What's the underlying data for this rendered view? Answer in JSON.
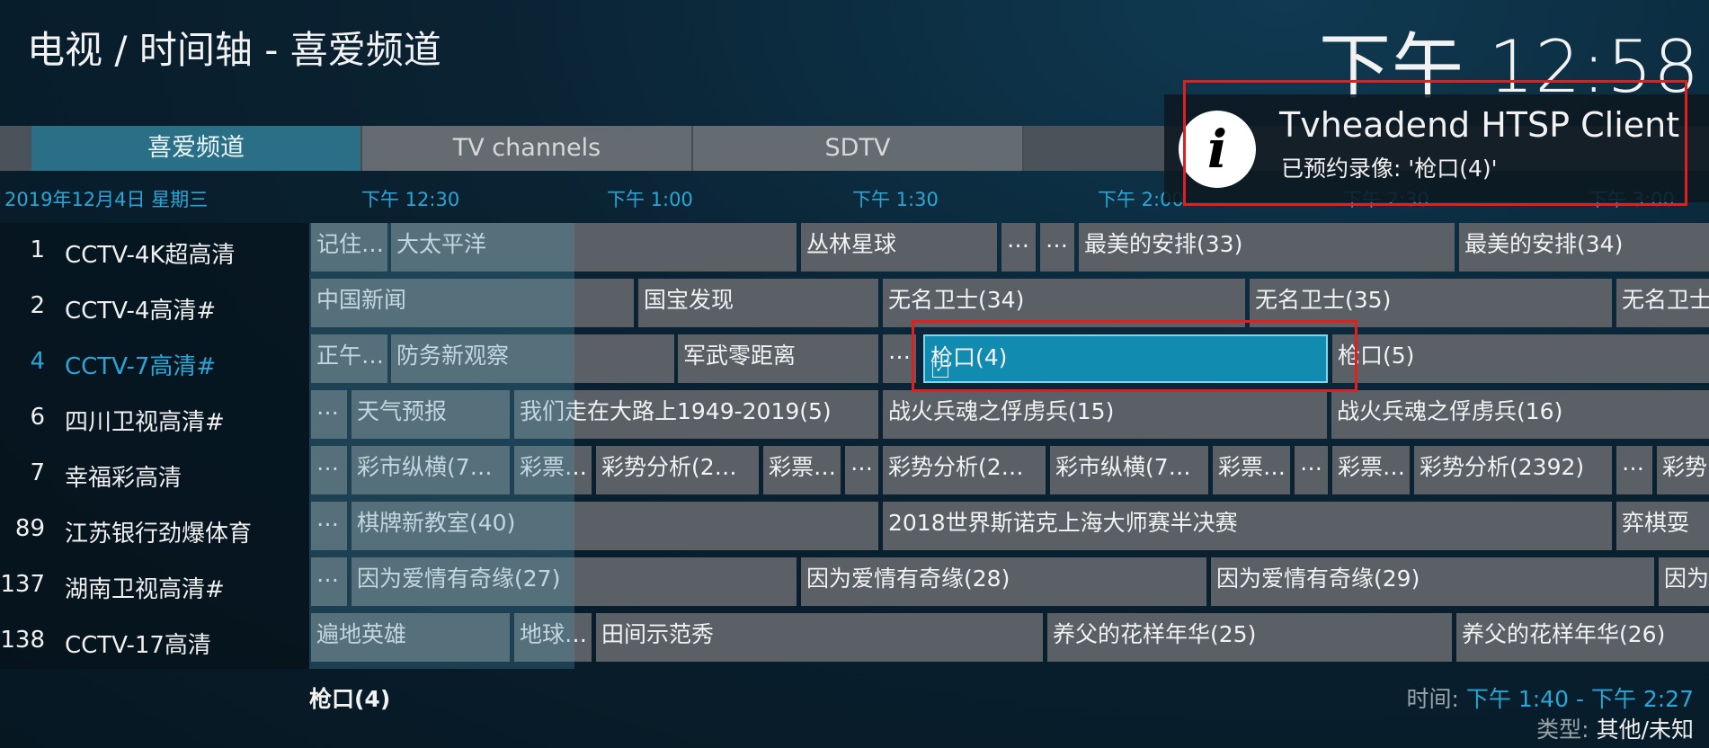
{
  "header": {
    "title": "电视 / 时间轴 - 喜爱频道",
    "clock": "下午 12:58"
  },
  "tabs": [
    {
      "label": "喜爱频道",
      "active": true
    },
    {
      "label": "TV channels",
      "active": false
    },
    {
      "label": "SDTV",
      "active": false
    }
  ],
  "date": "2019年12月4日 星期三",
  "times": [
    "下午 12:30",
    "下午 1:00",
    "下午 1:30",
    "下午 2:00",
    "下午 2:30",
    "下午 3:00"
  ],
  "channels": [
    {
      "num": "1",
      "name": "CCTV-4K超高清",
      "active": false
    },
    {
      "num": "2",
      "name": "CCTV-4高清#",
      "active": false
    },
    {
      "num": "4",
      "name": "CCTV-7高清#",
      "active": true
    },
    {
      "num": "6",
      "name": "四川卫视高清#",
      "active": false
    },
    {
      "num": "7",
      "name": "幸福彩高清",
      "active": false
    },
    {
      "num": "89",
      "name": "江苏银行劲爆体育",
      "active": false
    },
    {
      "num": "137",
      "name": "湖南卫视高清#",
      "active": false
    },
    {
      "num": "138",
      "name": "CCTV-17高清",
      "active": false
    }
  ],
  "programs": [
    [
      {
        "title": "记住…"
      },
      {
        "title": "大太平洋"
      },
      {
        "title": "丛林星球"
      },
      {
        "title": "…"
      },
      {
        "title": "…"
      },
      {
        "title": "最美的安排(33)"
      },
      {
        "title": "最美的安排(34)"
      }
    ],
    [
      {
        "title": "中国新闻"
      },
      {
        "title": "国宝发现"
      },
      {
        "title": "无名卫士(34)"
      },
      {
        "title": "无名卫士(35)"
      },
      {
        "title": "无名卫士"
      }
    ],
    [
      {
        "title": "正午…"
      },
      {
        "title": "防务新观察"
      },
      {
        "title": "军武零距离"
      },
      {
        "title": "…"
      },
      {
        "title": "枪口(4)",
        "selected": true,
        "timer": true
      },
      {
        "title": "枪口(5)"
      }
    ],
    [
      {
        "title": "…"
      },
      {
        "title": "天气预报"
      },
      {
        "title": "我们走在大路上1949-2019(5)"
      },
      {
        "title": "战火兵魂之俘虏兵(15)"
      },
      {
        "title": "战火兵魂之俘虏兵(16)"
      }
    ],
    [
      {
        "title": "…"
      },
      {
        "title": "彩市纵横(7…"
      },
      {
        "title": "彩票…"
      },
      {
        "title": "彩势分析(2…"
      },
      {
        "title": "彩票…"
      },
      {
        "title": "…"
      },
      {
        "title": "彩势分析(2…"
      },
      {
        "title": "彩市纵横(7…"
      },
      {
        "title": "彩票…"
      },
      {
        "title": "…"
      },
      {
        "title": "彩票…"
      },
      {
        "title": "彩势分析(2392)"
      },
      {
        "title": "…"
      },
      {
        "title": "彩势"
      }
    ],
    [
      {
        "title": "…"
      },
      {
        "title": "棋牌新教室(40)"
      },
      {
        "title": "2018世界斯诺克上海大师赛半决赛"
      },
      {
        "title": "弈棋耍"
      }
    ],
    [
      {
        "title": "…"
      },
      {
        "title": "因为爱情有奇缘(27)"
      },
      {
        "title": "因为爱情有奇缘(28)"
      },
      {
        "title": "因为爱情有奇缘(29)"
      },
      {
        "title": "因为"
      }
    ],
    [
      {
        "title": "遍地英雄"
      },
      {
        "title": "地球…"
      },
      {
        "title": "田间示范秀"
      },
      {
        "title": "养父的花样年华(25)"
      },
      {
        "title": "养父的花样年华(26)"
      }
    ]
  ],
  "notification": {
    "title": "Tvheadend HTSP Client",
    "message": "已预约录像: '枪口(4)'"
  },
  "info": {
    "title": "枪口(4)",
    "time_label": "时间:",
    "time_value": "下午 1:40 - 下午 2:27",
    "genre_label": "类型:",
    "genre_value": "其他/未知"
  }
}
